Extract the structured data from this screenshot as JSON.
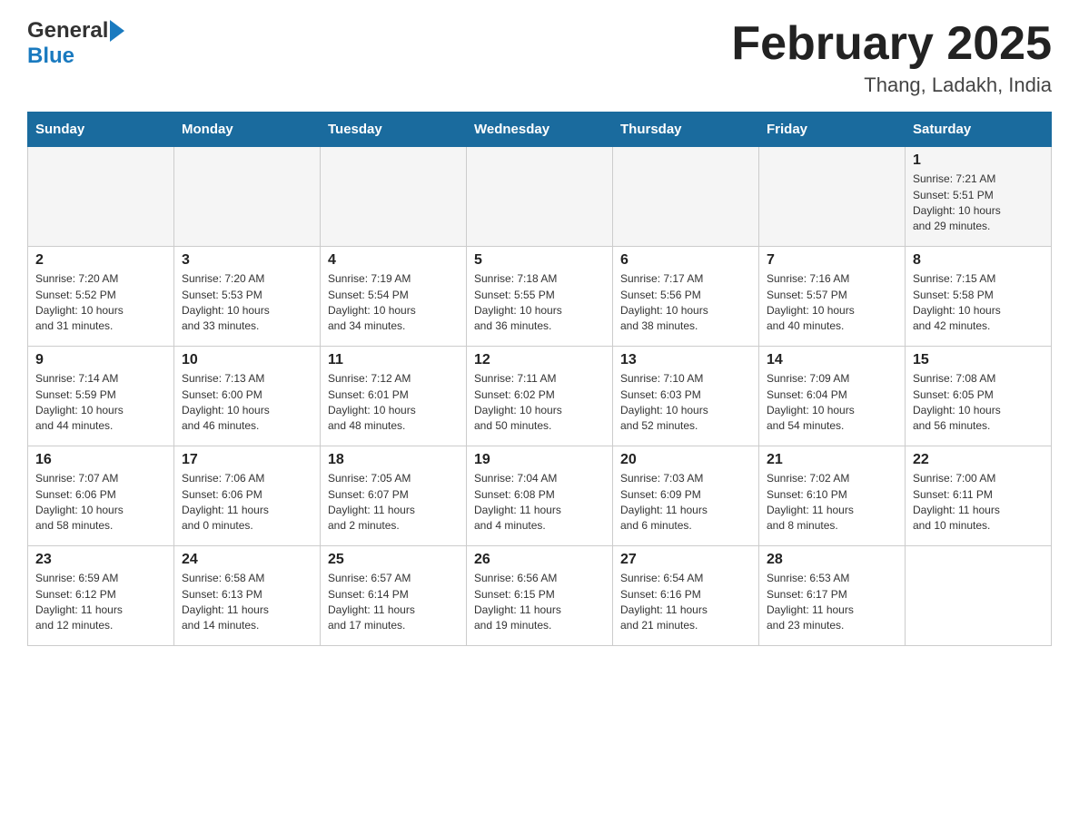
{
  "header": {
    "logo_general": "General",
    "logo_blue": "Blue",
    "month_title": "February 2025",
    "location": "Thang, Ladakh, India"
  },
  "weekdays": [
    "Sunday",
    "Monday",
    "Tuesday",
    "Wednesday",
    "Thursday",
    "Friday",
    "Saturday"
  ],
  "weeks": [
    [
      {
        "day": "",
        "info": ""
      },
      {
        "day": "",
        "info": ""
      },
      {
        "day": "",
        "info": ""
      },
      {
        "day": "",
        "info": ""
      },
      {
        "day": "",
        "info": ""
      },
      {
        "day": "",
        "info": ""
      },
      {
        "day": "1",
        "info": "Sunrise: 7:21 AM\nSunset: 5:51 PM\nDaylight: 10 hours\nand 29 minutes."
      }
    ],
    [
      {
        "day": "2",
        "info": "Sunrise: 7:20 AM\nSunset: 5:52 PM\nDaylight: 10 hours\nand 31 minutes."
      },
      {
        "day": "3",
        "info": "Sunrise: 7:20 AM\nSunset: 5:53 PM\nDaylight: 10 hours\nand 33 minutes."
      },
      {
        "day": "4",
        "info": "Sunrise: 7:19 AM\nSunset: 5:54 PM\nDaylight: 10 hours\nand 34 minutes."
      },
      {
        "day": "5",
        "info": "Sunrise: 7:18 AM\nSunset: 5:55 PM\nDaylight: 10 hours\nand 36 minutes."
      },
      {
        "day": "6",
        "info": "Sunrise: 7:17 AM\nSunset: 5:56 PM\nDaylight: 10 hours\nand 38 minutes."
      },
      {
        "day": "7",
        "info": "Sunrise: 7:16 AM\nSunset: 5:57 PM\nDaylight: 10 hours\nand 40 minutes."
      },
      {
        "day": "8",
        "info": "Sunrise: 7:15 AM\nSunset: 5:58 PM\nDaylight: 10 hours\nand 42 minutes."
      }
    ],
    [
      {
        "day": "9",
        "info": "Sunrise: 7:14 AM\nSunset: 5:59 PM\nDaylight: 10 hours\nand 44 minutes."
      },
      {
        "day": "10",
        "info": "Sunrise: 7:13 AM\nSunset: 6:00 PM\nDaylight: 10 hours\nand 46 minutes."
      },
      {
        "day": "11",
        "info": "Sunrise: 7:12 AM\nSunset: 6:01 PM\nDaylight: 10 hours\nand 48 minutes."
      },
      {
        "day": "12",
        "info": "Sunrise: 7:11 AM\nSunset: 6:02 PM\nDaylight: 10 hours\nand 50 minutes."
      },
      {
        "day": "13",
        "info": "Sunrise: 7:10 AM\nSunset: 6:03 PM\nDaylight: 10 hours\nand 52 minutes."
      },
      {
        "day": "14",
        "info": "Sunrise: 7:09 AM\nSunset: 6:04 PM\nDaylight: 10 hours\nand 54 minutes."
      },
      {
        "day": "15",
        "info": "Sunrise: 7:08 AM\nSunset: 6:05 PM\nDaylight: 10 hours\nand 56 minutes."
      }
    ],
    [
      {
        "day": "16",
        "info": "Sunrise: 7:07 AM\nSunset: 6:06 PM\nDaylight: 10 hours\nand 58 minutes."
      },
      {
        "day": "17",
        "info": "Sunrise: 7:06 AM\nSunset: 6:06 PM\nDaylight: 11 hours\nand 0 minutes."
      },
      {
        "day": "18",
        "info": "Sunrise: 7:05 AM\nSunset: 6:07 PM\nDaylight: 11 hours\nand 2 minutes."
      },
      {
        "day": "19",
        "info": "Sunrise: 7:04 AM\nSunset: 6:08 PM\nDaylight: 11 hours\nand 4 minutes."
      },
      {
        "day": "20",
        "info": "Sunrise: 7:03 AM\nSunset: 6:09 PM\nDaylight: 11 hours\nand 6 minutes."
      },
      {
        "day": "21",
        "info": "Sunrise: 7:02 AM\nSunset: 6:10 PM\nDaylight: 11 hours\nand 8 minutes."
      },
      {
        "day": "22",
        "info": "Sunrise: 7:00 AM\nSunset: 6:11 PM\nDaylight: 11 hours\nand 10 minutes."
      }
    ],
    [
      {
        "day": "23",
        "info": "Sunrise: 6:59 AM\nSunset: 6:12 PM\nDaylight: 11 hours\nand 12 minutes."
      },
      {
        "day": "24",
        "info": "Sunrise: 6:58 AM\nSunset: 6:13 PM\nDaylight: 11 hours\nand 14 minutes."
      },
      {
        "day": "25",
        "info": "Sunrise: 6:57 AM\nSunset: 6:14 PM\nDaylight: 11 hours\nand 17 minutes."
      },
      {
        "day": "26",
        "info": "Sunrise: 6:56 AM\nSunset: 6:15 PM\nDaylight: 11 hours\nand 19 minutes."
      },
      {
        "day": "27",
        "info": "Sunrise: 6:54 AM\nSunset: 6:16 PM\nDaylight: 11 hours\nand 21 minutes."
      },
      {
        "day": "28",
        "info": "Sunrise: 6:53 AM\nSunset: 6:17 PM\nDaylight: 11 hours\nand 23 minutes."
      },
      {
        "day": "",
        "info": ""
      }
    ]
  ]
}
